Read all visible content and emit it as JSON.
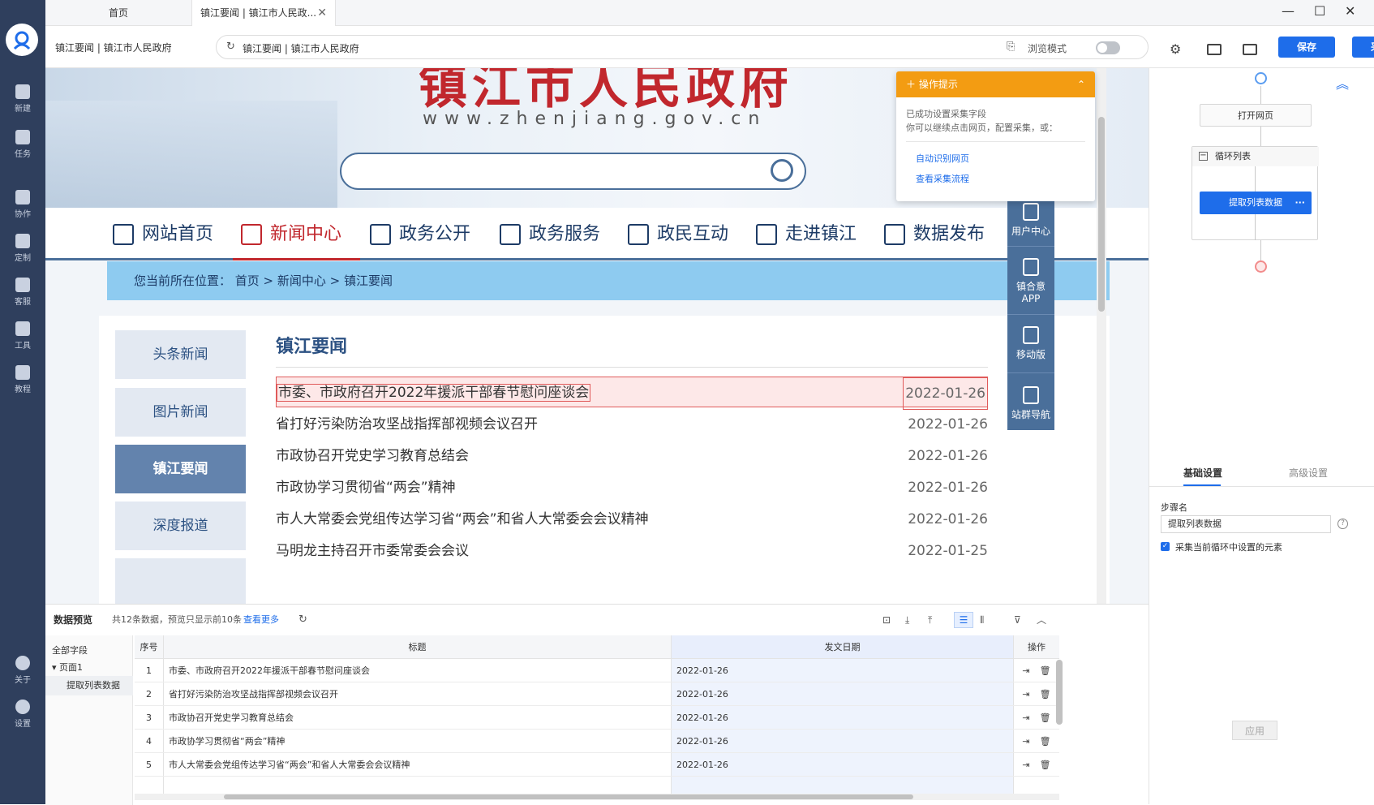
{
  "left_rail": {
    "items": [
      {
        "label": "新建",
        "icon": "new-icon"
      },
      {
        "label": "任务",
        "icon": "task-icon"
      },
      {
        "label": "协作",
        "icon": "collab-icon"
      },
      {
        "label": "定制",
        "icon": "custom-icon"
      },
      {
        "label": "客服",
        "icon": "headset-icon"
      },
      {
        "label": "工具",
        "icon": "toolbox-icon"
      },
      {
        "label": "教程",
        "icon": "tutorial-icon"
      },
      {
        "label": "关于",
        "icon": "info-icon"
      },
      {
        "label": "设置",
        "icon": "gear-icon"
      }
    ]
  },
  "tabs": {
    "home": "首页",
    "active": "镇江要闻 | 镇江市人民政..."
  },
  "address": {
    "page_name": "镇江要闻 | 镇江市人民政府",
    "url": "镇江要闻 | 镇江市人民政府",
    "browse_mode": "浏览模式",
    "save": "保存",
    "collect": "采集"
  },
  "site": {
    "title": "镇江市人民政府",
    "domain": "www.zhenjiang.gov.cn",
    "nav": [
      "网站首页",
      "新闻中心",
      "政务公开",
      "政务服务",
      "政民互动",
      "走进镇江",
      "数据发布"
    ],
    "breadcrumb": "您当前所在位置：  首页 > 新闻中心 > 镇江要闻",
    "side_links": [
      "头条新闻",
      "图片新闻",
      "镇江要闻",
      "深度报道"
    ],
    "section_title": "镇江要闻",
    "news": [
      {
        "title": "市委、市政府召开2022年援派干部春节慰问座谈会",
        "date": "2022-01-26"
      },
      {
        "title": "省打好污染防治攻坚战指挥部视频会议召开",
        "date": "2022-01-26"
      },
      {
        "title": "市政协召开党史学习教育总结会",
        "date": "2022-01-26"
      },
      {
        "title": "市政协学习贯彻省“两会”精神",
        "date": "2022-01-26"
      },
      {
        "title": "市人大常委会党组传达学习省“两会”和省人大常委会会议精神",
        "date": "2022-01-26"
      },
      {
        "title": "马明龙主持召开市委常委会会议",
        "date": "2022-01-25"
      }
    ],
    "float_menu": [
      "用户中心",
      "镇合意APP",
      "移动版",
      "站群导航"
    ]
  },
  "tip": {
    "header": "操作提示",
    "line1": "已成功设置采集字段",
    "line2": "你可以继续点击网页，配置采集，或：",
    "link1": "自动识别网页",
    "link2": "查看采集流程"
  },
  "flow": {
    "open_page": "打开网页",
    "loop_list": "循环列表",
    "extract": "提取列表数据",
    "tab_basic": "基础设置",
    "tab_advanced": "高级设置",
    "step_name_label": "步骤名",
    "step_name_value": "提取列表数据",
    "checkbox_label": "采集当前循环中设置的元素",
    "checkbox_checked": true,
    "apply": "应用"
  },
  "preview": {
    "title": "数据预览",
    "count_text": "共12条数据，预览只显示前10条",
    "more": "查看更多",
    "tree_all": "全部字段",
    "tree_page": "页面1",
    "tree_leaf": "提取列表数据",
    "columns": {
      "idx": "序号",
      "title": "标题",
      "date": "发文日期",
      "op": "操作"
    },
    "rows": [
      {
        "idx": "1",
        "title": "市委、市政府召开2022年援派干部春节慰问座谈会",
        "date": "2022-01-26"
      },
      {
        "idx": "2",
        "title": "省打好污染防治攻坚战指挥部视频会议召开",
        "date": "2022-01-26"
      },
      {
        "idx": "3",
        "title": "市政协召开党史学习教育总结会",
        "date": "2022-01-26"
      },
      {
        "idx": "4",
        "title": "市政协学习贯彻省“两会”精神",
        "date": "2022-01-26"
      },
      {
        "idx": "5",
        "title": "市人大常委会党组传达学习省“两会”和省人大常委会会议精神",
        "date": "2022-01-26"
      }
    ]
  },
  "colors": {
    "accent": "#1e6dea",
    "rail": "#2f3f5d",
    "tip": "#f39c12",
    "site_red": "#c1272d"
  }
}
